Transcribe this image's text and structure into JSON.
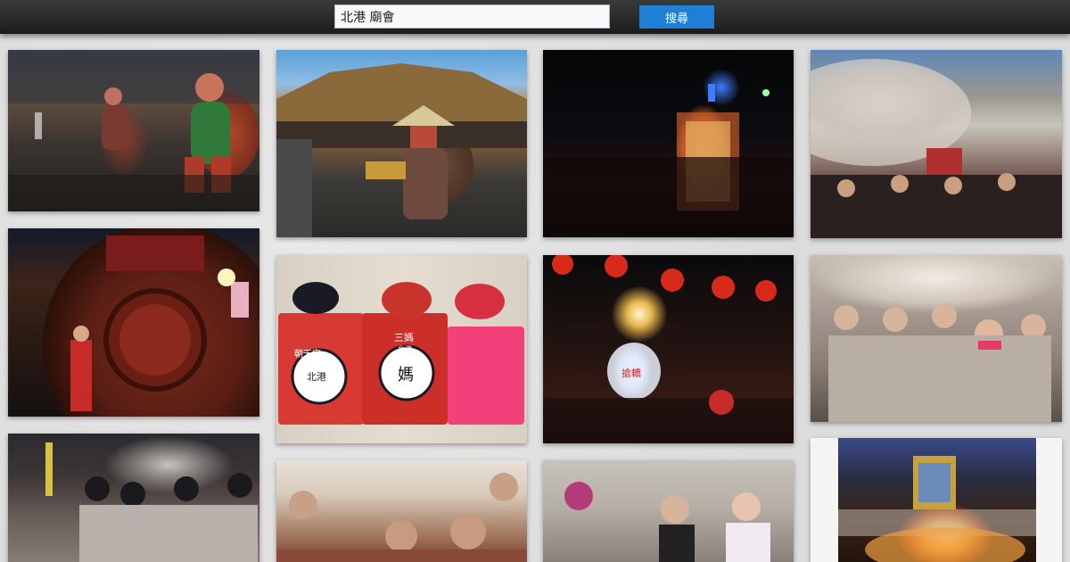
{
  "search": {
    "value": "北港 廟會",
    "button_label": "搜尋"
  },
  "gallery": {
    "photos": [
      {
        "subject": "masked-giant-puppets-street"
      },
      {
        "subject": "temple-roof-straw-hat-performer"
      },
      {
        "subject": "night-palanquin-procession"
      },
      {
        "subject": "firecracker-smoke-crowd"
      },
      {
        "subject": "ceremonial-drum-cart"
      },
      {
        "subject": "red-festival-shirts-and-caps"
      },
      {
        "subject": "glowing-lantern-night"
      },
      {
        "subject": "participants-covering-ears"
      },
      {
        "subject": "crowd-with-helmets-smoke"
      },
      {
        "subject": "incense-holders-street"
      },
      {
        "subject": "masked-participant-street"
      },
      {
        "subject": "palanquin-fireworks"
      }
    ],
    "shirt_texts": {
      "left_header": "朝天宮",
      "left_badge": "北港",
      "middle_cap": "三媽",
      "middle_badge": "媽",
      "middle_sub": "北港",
      "lantern_text": "搶轎"
    }
  }
}
